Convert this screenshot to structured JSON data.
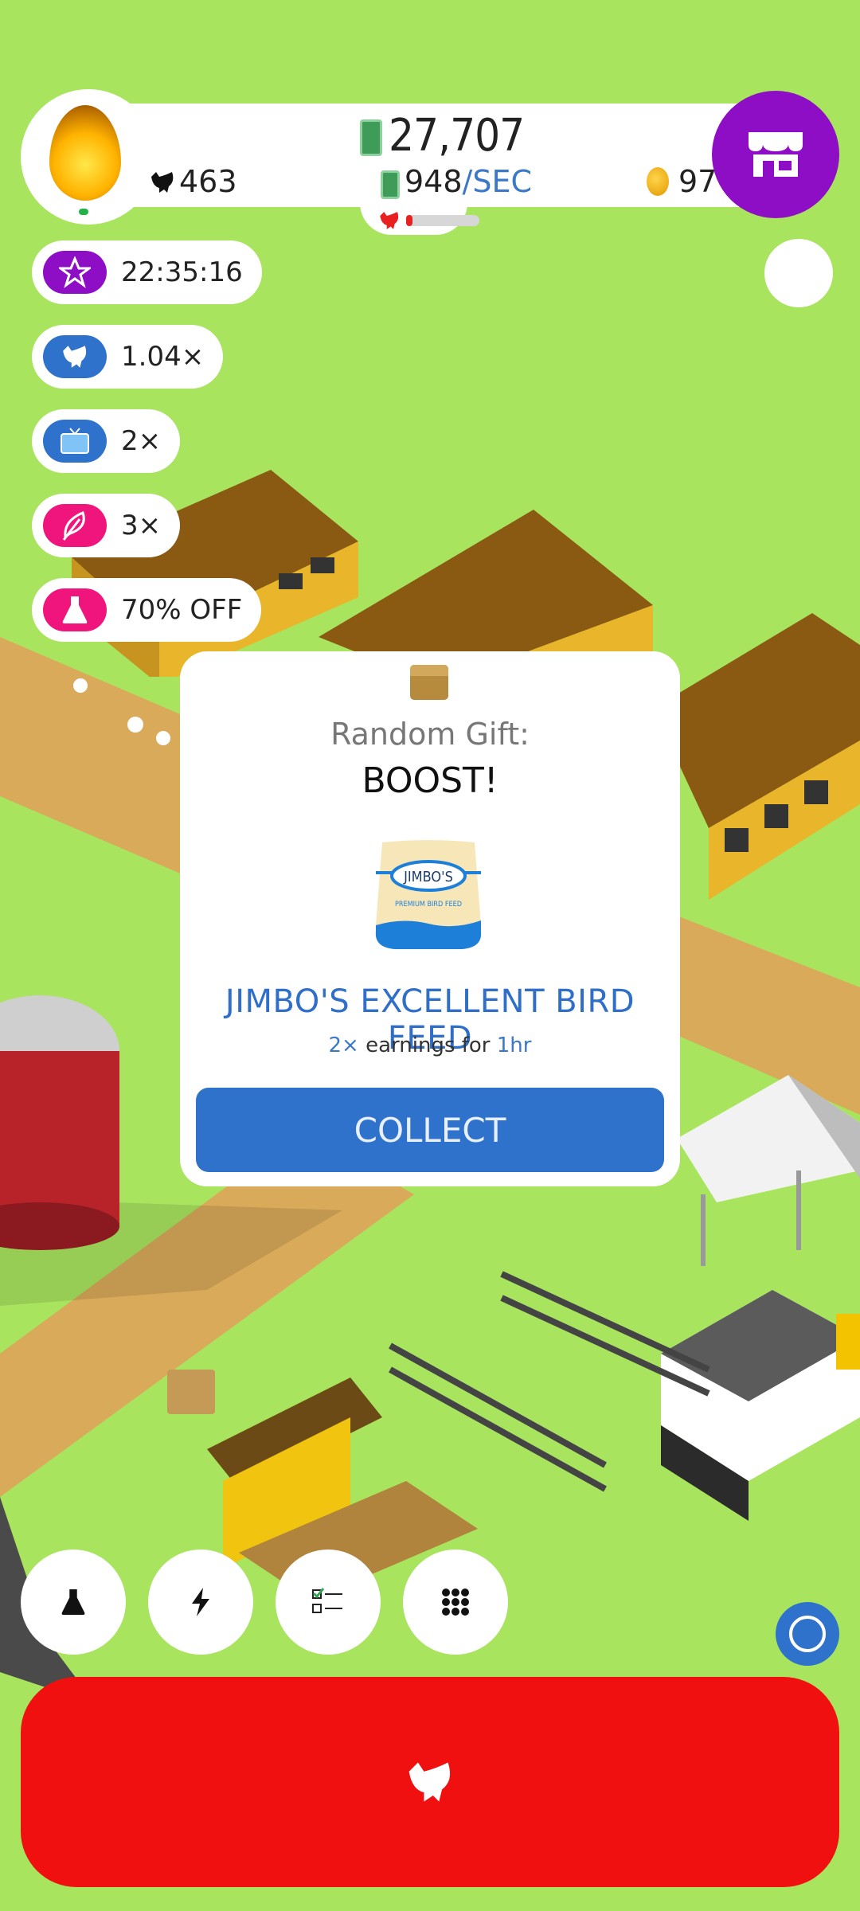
{
  "header": {
    "money": "27,707",
    "per_sec_value": "948",
    "per_sec_unit": "/SEC",
    "chickens": "463",
    "golden_eggs": "97",
    "hatchery_progress": 0.05
  },
  "boosts": [
    {
      "label": "22:35:16",
      "icon": "star-icon",
      "color": "#8d0ec4"
    },
    {
      "label": "1.04×",
      "icon": "chicken-icon",
      "color": "#2e72cc"
    },
    {
      "label": "2×",
      "icon": "tv-icon",
      "color": "#2e72cc"
    },
    {
      "label": "3×",
      "icon": "feather-icon",
      "color": "#f0157c"
    },
    {
      "label": "70% OFF",
      "icon": "flask-icon",
      "color": "#f0157c"
    }
  ],
  "dialog": {
    "subtitle": "Random Gift:",
    "title": "BOOST!",
    "bag_brand": "JIMBO'S",
    "bag_tagline": "PREMIUM BIRD FEED",
    "item_name": "JIMBO'S EXCELLENT BIRD FEED",
    "desc_multiplier": "2×",
    "desc_middle": " earnings for ",
    "desc_duration": "1hr",
    "button_label": "COLLECT"
  },
  "bottom_bar": {
    "buttons": [
      "flask-icon",
      "lightning-icon",
      "checklist-icon",
      "grid-icon"
    ]
  },
  "colors": {
    "grass": "#a9e45f",
    "shop": "#8d0ec4",
    "collect": "#2e72cc",
    "hatch": "#f01010"
  }
}
